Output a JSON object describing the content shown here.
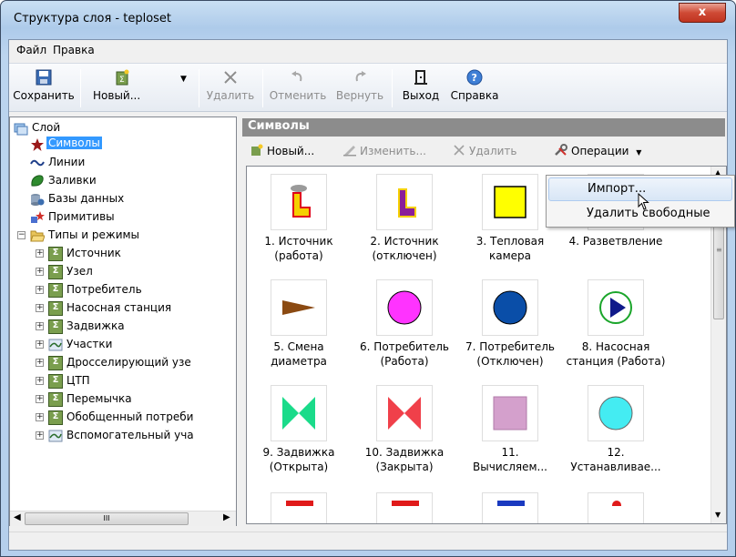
{
  "window": {
    "title": "Структура слоя - teploset",
    "close_glyph": "x"
  },
  "menu": {
    "items": [
      "Файл",
      "Правка"
    ]
  },
  "toolbar": {
    "save": "Сохранить",
    "new": "Новый...",
    "delete": "Удалить",
    "undo": "Отменить",
    "redo": "Вернуть",
    "exit": "Выход",
    "help": "Справка"
  },
  "tree": {
    "root": "Слой",
    "items": [
      "Символы",
      "Линии",
      "Заливки",
      "Базы данных",
      "Примитивы"
    ],
    "group": "Типы и режимы",
    "group_items": [
      "Источник",
      "Узел",
      "Потребитель",
      "Насосная станция",
      "Задвижка",
      "Участки",
      "Дросселирующий узе",
      "ЦТП",
      "Перемычка",
      "Обобщенный потреби",
      "Вспомогательный уча"
    ],
    "scroll_thumb": "III"
  },
  "symbols": {
    "header": "Символы",
    "toolbar": {
      "new": "Новый...",
      "edit": "Изменить...",
      "delete": "Удалить",
      "operations": "Операции"
    },
    "items": [
      "1. Источник\n(работа)",
      "2. Источник\n(отключен)",
      "3. Тепловая\nкамера",
      "4. Разветвление",
      "5. Смена\nдиаметра",
      "6. Потребитель\n(Работа)",
      "7. Потребитель\n(Отключен)",
      "8. Насосная\nстанция (Работа)",
      "9. Задвижка\n(Открыта)",
      "10. Задвижка\n(Закрыта)",
      "11.\nВычисляем...",
      "12.\nУстанавливае..."
    ]
  },
  "dropdown": {
    "items": [
      "Импорт...",
      "Удалить свободные"
    ]
  },
  "colors": {
    "accent": "#3399ff",
    "header": "#8c8c8c"
  }
}
